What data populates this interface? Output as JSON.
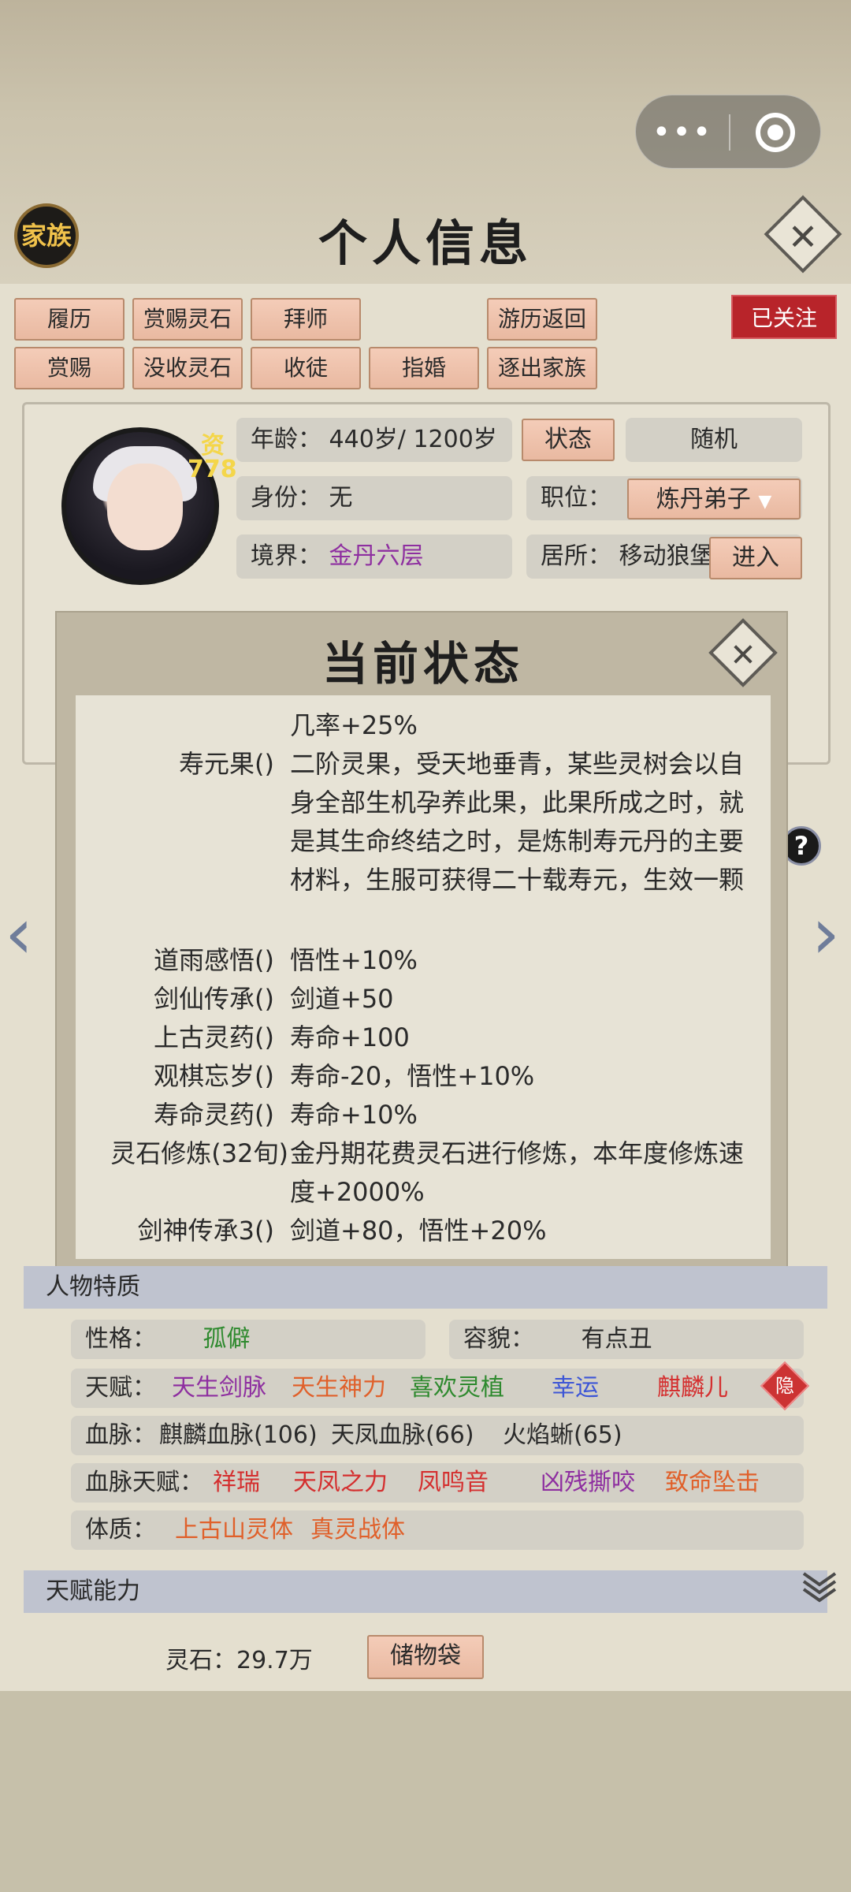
{
  "header": {
    "clan_label": "家族",
    "title": "个人信息",
    "menu_dots": "•••",
    "close_glyph": "✕"
  },
  "actions": {
    "row1": [
      "履历",
      "赏赐灵石",
      "拜师",
      "游历返回"
    ],
    "row2": [
      "赏赐",
      "没收灵石",
      "收徒",
      "指婚",
      "逐出家族"
    ],
    "followed": "已关注"
  },
  "profile": {
    "zi": "资",
    "aptitude": "778",
    "age_label": "年龄：",
    "age_value": "440岁/ 1200岁",
    "status_button": "状态",
    "random_button": "随机",
    "identity_label": "身份：",
    "identity_value": "无",
    "position_label": "职位：",
    "position_value": "炼丹弟子",
    "realm_label": "境界：",
    "realm_value": "金丹六层",
    "residence_label": "居所：",
    "residence_value": "移动狼堡",
    "enter_button": "进入"
  },
  "modal": {
    "title": "当前状态",
    "rows": [
      {
        "k": "",
        "v": "几率+25%"
      },
      {
        "k": "寿元果()",
        "v": "二阶灵果，受天地垂青，某些灵树会以自身全部生机孕养此果，此果所成之时，就是其生命终结之时，是炼制寿元丹的主要材料，生服可获得二十载寿元，生效一颗"
      },
      {
        "k": "道雨感悟()",
        "v": "悟性+10%"
      },
      {
        "k": "剑仙传承()",
        "v": "剑道+50"
      },
      {
        "k": "上古灵药()",
        "v": "寿命+100"
      },
      {
        "k": "观棋忘岁()",
        "v": "寿命-20，悟性+10%"
      },
      {
        "k": "寿命灵药()",
        "v": "寿命+10%"
      },
      {
        "k": "灵石修炼(32旬)",
        "v": "金丹期花费灵石进行修炼，本年度修炼速度+2000%"
      },
      {
        "k": "剑神传承3()",
        "v": "剑道+80，悟性+20%"
      }
    ]
  },
  "traits": {
    "section_title": "人物特质",
    "personality_label": "性格：",
    "personality_value": "孤僻",
    "looks_label": "容貌：",
    "looks_value": "有点丑",
    "talent_label": "天赋：",
    "talents": [
      "天生剑脉",
      "天生神力",
      "喜欢灵植",
      "幸运",
      "麒麟儿"
    ],
    "hidden_badge": "隐",
    "bloodline_label": "血脉：",
    "bloodlines": [
      "麒麟血脉(106)",
      "天凤血脉(66)",
      "火焰蜥(65)"
    ],
    "bloodline_talent_label": "血脉天赋：",
    "bloodline_talents": [
      "祥瑞",
      "天凤之力",
      "凤鸣音",
      "凶残撕咬",
      "致命坠击"
    ],
    "constitution_label": "体质：",
    "constitutions": [
      "上古山灵体",
      "真灵战体"
    ]
  },
  "abilities": {
    "section_title": "天赋能力"
  },
  "footer": {
    "spirit_stone": "灵石：29.7万",
    "bag_button": "储物袋"
  },
  "nav": {
    "prev": "‹",
    "next": "›",
    "help": "?"
  }
}
